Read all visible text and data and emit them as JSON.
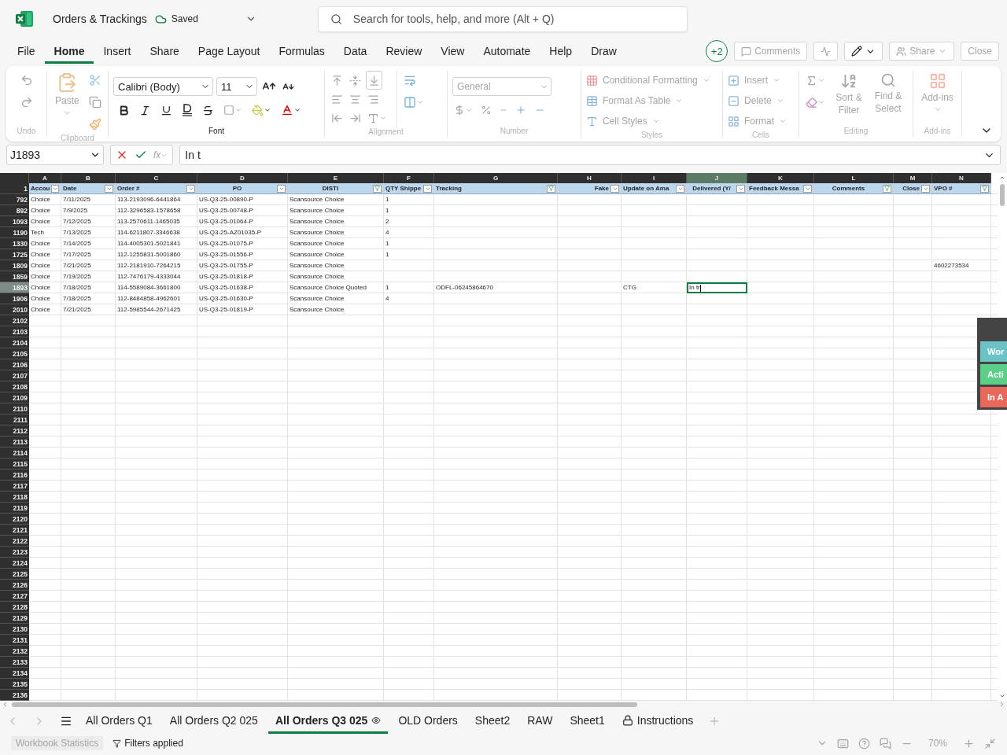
{
  "title_bar": {
    "app_title": "Orders & Trackings",
    "save_status": "Saved",
    "search": {
      "placeholder": "Search for tools, help, and more (Alt + Q)"
    }
  },
  "menu": [
    {
      "label": "File",
      "selected": false
    },
    {
      "label": "Home",
      "selected": true
    },
    {
      "label": "Insert",
      "selected": false
    },
    {
      "label": "Share",
      "selected": false
    },
    {
      "label": "Page Layout",
      "selected": false
    },
    {
      "label": "Formulas",
      "selected": false
    },
    {
      "label": "Data",
      "selected": false
    },
    {
      "label": "Review",
      "selected": false
    },
    {
      "label": "View",
      "selected": false
    },
    {
      "label": "Automate",
      "selected": false
    },
    {
      "label": "Help",
      "selected": false
    },
    {
      "label": "Draw",
      "selected": false
    }
  ],
  "menu_actions": {
    "collaborators": "+2",
    "comments": {
      "label": "Comments",
      "disabled": true
    },
    "share": {
      "label": "Share",
      "disabled": true
    },
    "close": {
      "label": "Close",
      "disabled": true
    }
  },
  "ribbon": {
    "undo": {
      "label": "Undo",
      "disabled": true
    },
    "clipboard": {
      "label": "Clipboard",
      "paste": "Paste",
      "disabled": true
    },
    "font": {
      "label": "Font",
      "font_name": "Calibri (Body)",
      "font_size": "11",
      "disabled": false
    },
    "alignment": {
      "label": "Alignment",
      "disabled": true
    },
    "number": {
      "label": "Number",
      "format": "General",
      "disabled": true
    },
    "styles": {
      "label": "Styles",
      "items": [
        "Conditional Formatting",
        "Format As Table",
        "Cell Styles"
      ],
      "disabled": true
    },
    "cells": {
      "label": "Cells",
      "items": [
        "Insert",
        "Delete",
        "Format"
      ],
      "disabled": true
    },
    "editing": {
      "label": "Editing",
      "sort": "Sort & Filter",
      "find": "Find & Select",
      "disabled": true
    },
    "addins": {
      "label": "Add-ins",
      "button": "Add-ins",
      "disabled": true
    }
  },
  "formula_bar": {
    "name_box": "J1893",
    "function_label": "fx",
    "value": "In t"
  },
  "sheet": {
    "columns": [
      {
        "letter": "A",
        "label": "Accou",
        "filtered": false,
        "selected": false
      },
      {
        "letter": "B",
        "label": "Date",
        "filtered": false,
        "selected": false
      },
      {
        "letter": "C",
        "label": "Order #",
        "filtered": false,
        "selected": false
      },
      {
        "letter": "D",
        "label": "PO",
        "filtered": false,
        "selected": false
      },
      {
        "letter": "E",
        "label": "DISTI",
        "filtered": true,
        "selected": false
      },
      {
        "letter": "F",
        "label": "QTY Shippe",
        "filtered": false,
        "selected": false
      },
      {
        "letter": "G",
        "label": "Tracking",
        "filtered": true,
        "selected": false
      },
      {
        "letter": "H",
        "label": "Fake",
        "filtered": false,
        "selected": false
      },
      {
        "letter": "I",
        "label": "Update on Ama",
        "filtered": false,
        "selected": false
      },
      {
        "letter": "J",
        "label": "Delivered (Y/",
        "filtered": false,
        "selected": true
      },
      {
        "letter": "K",
        "label": "Feedback Messa",
        "filtered": false,
        "selected": false
      },
      {
        "letter": "L",
        "label": "Comments",
        "filtered": true,
        "selected": false
      },
      {
        "letter": "M",
        "label": "Close",
        "filtered": false,
        "selected": false
      },
      {
        "letter": "N",
        "label": "VPO #",
        "filtered": true,
        "selected": false
      }
    ],
    "header_row": "1",
    "rows": [
      {
        "number": "792",
        "selected": false,
        "cells": {
          "A": "Choice",
          "B": "7/11/2025",
          "C": "113-2193096-6441864",
          "D": "US-Q3-25-00890-P",
          "E": "Scansource Choice",
          "F": "1"
        }
      },
      {
        "number": "892",
        "selected": false,
        "cells": {
          "A": "Choice",
          "B": "7/9/2025",
          "C": "112-3296583-1578658",
          "D": "US-Q3-25-00748-P",
          "E": "Scansource Choice",
          "F": "1"
        }
      },
      {
        "number": "1093",
        "selected": false,
        "cells": {
          "A": "Choice",
          "B": "7/12/2025",
          "C": "113-2570611-1465035",
          "D": "US-Q3-25-01064-P",
          "E": "Scansource Choice",
          "F": "2"
        }
      },
      {
        "number": "1190",
        "selected": false,
        "cells": {
          "A": "Tech",
          "B": "7/13/2025",
          "C": "114-6211807-3346638",
          "D": "US-Q3-25-AZ01035-P",
          "E": "Scansource Choice",
          "F": "4"
        }
      },
      {
        "number": "1330",
        "selected": false,
        "cells": {
          "A": "Choice",
          "B": "7/14/2025",
          "C": "114-4005301-5021841",
          "D": "US-Q3-25-01075-P",
          "E": "Scansource Choice",
          "F": "1"
        }
      },
      {
        "number": "1725",
        "selected": false,
        "cells": {
          "A": "Choice",
          "B": "7/17/2025",
          "C": "112-1255831-5001860",
          "D": "US-Q3-25-01556-P",
          "E": "Scansource Choice",
          "F": "1"
        }
      },
      {
        "number": "1809",
        "selected": false,
        "cells": {
          "A": "Choice",
          "B": "7/21/2025",
          "C": "112-2181910-7264215",
          "D": "US-Q3-25-01755-P",
          "E": "Scansource Choice",
          "N": "4602273534"
        }
      },
      {
        "number": "1859",
        "selected": false,
        "cells": {
          "A": "Choice",
          "B": "7/19/2025",
          "C": "112-7476179-4333044",
          "D": "US-Q3-25-01818-P",
          "E": "Scansource Choice"
        }
      },
      {
        "number": "1893",
        "selected": true,
        "cells": {
          "A": "Choice",
          "B": "7/18/2025",
          "C": "114-5589084-3661800",
          "D": "US-Q3-25-01638-P",
          "E": "Scansource Choice Quoted",
          "F": "1",
          "G": "ODFL-06245864670",
          "I": "CTG",
          "J": "In tr"
        }
      },
      {
        "number": "1906",
        "selected": false,
        "cells": {
          "A": "Choice",
          "B": "7/18/2025",
          "C": "112-8484858-4962601",
          "D": "US-Q3-25-01630-P",
          "E": "Scansource Choice",
          "F": "4"
        }
      },
      {
        "number": "2010",
        "selected": false,
        "cells": {
          "A": "Choice",
          "B": "7/21/2025",
          "C": "112-5985544-2671425",
          "D": "US-Q3-25-01819-P",
          "E": "Scansource Choice"
        }
      }
    ],
    "empty_rows": [
      "2102",
      "2103",
      "2104",
      "2105",
      "2106",
      "2107",
      "2108",
      "2109",
      "2110",
      "2111",
      "2112",
      "2113",
      "2114",
      "2115",
      "2116",
      "2117",
      "2118",
      "2119",
      "2120",
      "2121",
      "2122",
      "2123",
      "2124",
      "2125",
      "2126",
      "2127",
      "2128",
      "2129",
      "2130",
      "2131",
      "2132",
      "2133",
      "2134",
      "2135",
      "2136"
    ]
  },
  "side_panel": {
    "buttons": [
      {
        "label": "Wor",
        "color": "#6cc3c6"
      },
      {
        "label": "Acti",
        "color": "#5ccf87"
      },
      {
        "label": "In A",
        "color": "#e9685c"
      }
    ]
  },
  "sheet_tabs": [
    {
      "label": "All Orders Q1",
      "selected": false,
      "kind": "plain"
    },
    {
      "label": "All Orders Q2 025",
      "selected": false,
      "kind": "plain"
    },
    {
      "label": "All Orders Q3 025",
      "selected": true,
      "kind": "view"
    },
    {
      "label": "OLD Orders",
      "selected": false,
      "kind": "plain"
    },
    {
      "label": "Sheet2",
      "selected": false,
      "kind": "plain"
    },
    {
      "label": "RAW",
      "selected": false,
      "kind": "plain"
    },
    {
      "label": "Sheet1",
      "selected": false,
      "kind": "plain"
    },
    {
      "label": "Instructions",
      "selected": false,
      "kind": "locked"
    }
  ],
  "status_bar": {
    "statistics": "Workbook Statistics",
    "filters": "Filters applied",
    "zoom": "70%"
  }
}
